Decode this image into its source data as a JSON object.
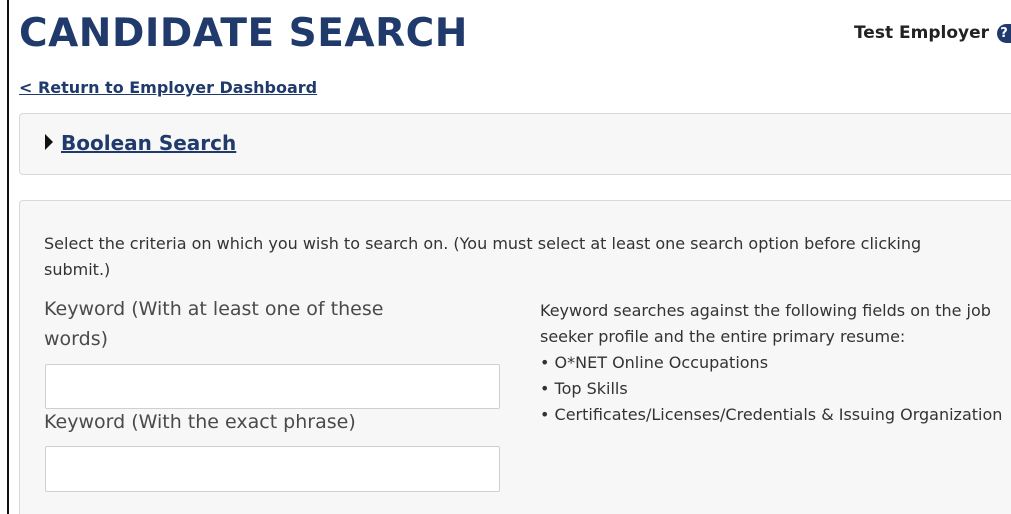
{
  "header": {
    "title": "CANDIDATE SEARCH",
    "user_name": "Test Employer",
    "help_glyph": "?"
  },
  "nav": {
    "return_link": "< Return to Employer Dashboard"
  },
  "boolean_panel": {
    "toggle_label": "Boolean Search"
  },
  "criteria": {
    "instructions": "Select the criteria on which you wish to search on. (You must select at least one search option before clicking submit.)",
    "keyword_any": {
      "label": "Keyword (With at least one of these words)",
      "value": ""
    },
    "keyword_exact": {
      "label": "Keyword (With the exact phrase)",
      "value": ""
    },
    "help": {
      "intro": "Keyword searches against the following fields on the job seeker profile and the entire primary resume:",
      "items": [
        "O*NET Online Occupations",
        "Top Skills",
        "Certificates/Licenses/Credentials & Issuing Organization"
      ]
    }
  },
  "colors": {
    "brand": "#1f3a6b",
    "panel_bg": "#f7f7f7",
    "border": "#d9d9d9"
  },
  "icons": {
    "help": "question-circle-icon",
    "expand": "caret-right-icon"
  }
}
